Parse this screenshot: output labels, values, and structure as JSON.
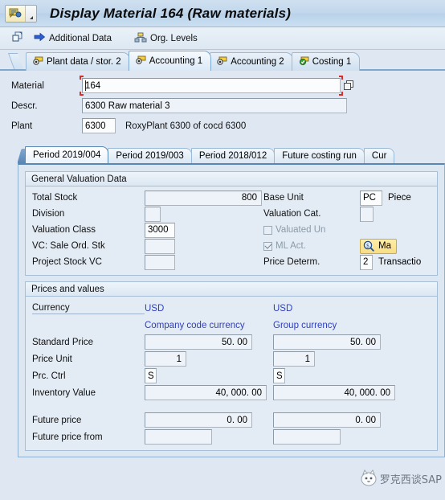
{
  "window": {
    "title": "Display Material 164 (Raw materials)",
    "system_icon": "material-master-icon",
    "menu_arrow_icon": "dropdown-arrow-icon"
  },
  "toolbar": {
    "items": [
      {
        "id": "display-change-button",
        "icon": "copy-document-icon",
        "label": ""
      },
      {
        "id": "additional-data-button",
        "icon": "arrow-right-icon",
        "label": "Additional Data"
      },
      {
        "id": "org-levels-button",
        "icon": "org-levels-icon",
        "label": "Org. Levels"
      }
    ]
  },
  "main_tabs": [
    {
      "label": "Plant data / stor. 2",
      "icon": "view-tab-icon",
      "selected": false
    },
    {
      "label": "Accounting 1",
      "icon": "view-tab-icon",
      "selected": true
    },
    {
      "label": "Accounting 2",
      "icon": "view-tab-icon",
      "selected": false
    },
    {
      "label": "Costing 1",
      "icon": "view-tab-check-icon",
      "selected": false
    }
  ],
  "header": {
    "material": {
      "label": "Material",
      "value": "164",
      "placeholder": "",
      "matchcode_icon": "matchcode-icon"
    },
    "descr": {
      "label": "Descr.",
      "value": "6300 Raw material 3"
    },
    "plant": {
      "label": "Plant",
      "value": "6300",
      "text": "RoxyPlant 6300 of cocd 6300"
    }
  },
  "period_tabs": [
    {
      "label": "Period 2019/004",
      "selected": true
    },
    {
      "label": "Period 2019/003",
      "selected": false
    },
    {
      "label": "Period 2018/012",
      "selected": false
    },
    {
      "label": "Future costing run",
      "selected": false
    },
    {
      "label": "Cur",
      "selected": false
    }
  ],
  "general_valuation": {
    "title": "General Valuation Data",
    "total_stock": {
      "label": "Total Stock",
      "value": "800"
    },
    "base_unit": {
      "label": "Base Unit",
      "value": "PC",
      "text": "Piece"
    },
    "division": {
      "label": "Division",
      "value": ""
    },
    "valuation_cat": {
      "label": "Valuation Cat.",
      "value": ""
    },
    "valuation_class": {
      "label": "Valuation Class",
      "value": "3000"
    },
    "valuated_un": {
      "label": "Valuated Un",
      "checked": false
    },
    "vc_sale_ord_stk": {
      "label": "VC: Sale Ord. Stk",
      "value": ""
    },
    "ml_act": {
      "label": "ML Act.",
      "checked": true
    },
    "ml_button": {
      "label": "Ma",
      "icon": "magnifier-dollar-icon"
    },
    "project_stock_vc": {
      "label": "Project Stock VC",
      "value": ""
    },
    "price_determ": {
      "label": "Price Determ.",
      "value": "2",
      "text": "Transactio"
    }
  },
  "prices_and_values": {
    "title": "Prices and values",
    "currency_label": "Currency",
    "currency_company": "USD",
    "currency_group": "USD",
    "col1_header": "Company code currency",
    "col2_header": "Group currency",
    "rows": [
      {
        "label": "Standard Price",
        "col1": "50. 00",
        "col2": "50. 00",
        "align": "right",
        "width": "wide"
      },
      {
        "label": "Price Unit",
        "col1": "1",
        "col2": "1",
        "align": "right",
        "width": "narrow"
      },
      {
        "label": "Prc. Ctrl",
        "col1": "S",
        "col2": "S",
        "align": "left",
        "width": "tiny"
      },
      {
        "label": "Inventory Value",
        "col1": "40, 000. 00",
        "col2": "40, 000. 00",
        "align": "right",
        "width": "wide"
      }
    ],
    "future_rows": [
      {
        "label": "Future price",
        "col1": "0. 00",
        "col2": "0. 00",
        "align": "right",
        "width": "wide"
      },
      {
        "label": "Future price from",
        "col1": "",
        "col2": "",
        "align": "left",
        "width": "wide"
      }
    ]
  },
  "watermark": {
    "text": "罗克西谈SAP",
    "icon": "cat-avatar-icon"
  },
  "colors": {
    "window_bg": "#dfe8f2",
    "title_bar": "#c2d7ec",
    "tab_selected": "#f6fafe",
    "field_bg": "#eef3f9",
    "link_blue": "#2f3fbd",
    "accent_border": "#5a86b3",
    "gold_button": "#f7dd86"
  }
}
